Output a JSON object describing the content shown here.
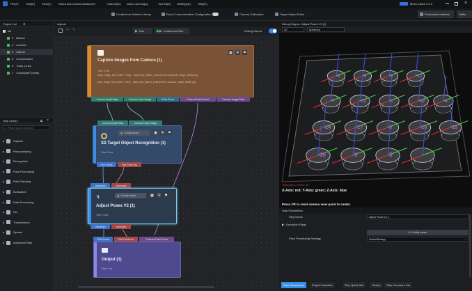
{
  "menubar": {
    "items": [
      "File(F)",
      "Edit(E)",
      "View(V)",
      "Robot and Communication(R)",
      "Camera(C)",
      "Deep Learning(L)",
      "Tool Kit(K)",
      "Settings(S)",
      "Help(H)"
    ],
    "brand": "Mech-Vision 2.0.0"
  },
  "toolbar": {
    "create_from_solution": "Create from Solution Library",
    "robot_comm_config": "Robot Communication Configuration",
    "camera_calibration": "Camera Calibration",
    "target_object_editor": "Target Object Editor",
    "production_interface": "Production Interface",
    "extra": "Settin"
  },
  "project_list": {
    "title": "Project List",
    "items": [
      {
        "index": "",
        "label": "list"
      },
      {
        "index": "2",
        "label": "Beams"
      },
      {
        "index": "3",
        "label": "connect"
      },
      {
        "index": "4",
        "label": "objects"
      },
      {
        "index": "5",
        "label": "Compression"
      },
      {
        "index": "6",
        "label": "Track_Links"
      },
      {
        "index": "7",
        "label": "Crankshaft (Small)"
      }
    ]
  },
  "step_library": {
    "title": "Step Library",
    "search_placeholder": "Please input a keyword",
    "items": [
      "Capture",
      "Preprocessing",
      "Recognition",
      "Pose Processing",
      "Path Planning",
      "Evaluation",
      "Data Processing",
      "File",
      "Transmission",
      "System",
      "Advanced Step"
    ]
  },
  "canvas": {
    "tab": "objects",
    "run_label": "Run",
    "continuous_run_label": "Continuous Run",
    "debug_output_label": "Debug Output",
    "nodes": {
      "capture": {
        "title": "Capture Images from Camera (1)",
        "time": "Time: 27ms",
        "line1": "depth_image_size: [1280 * 1024]...  /Mech-Eye_Stereo_2023-05-09-1-ms/depth_image_00000.png",
        "line2": "color_image_size: [1280 * 1024]...  /Mech-Eye_Stereo_2023-05-09-1-ms/color_image_00000.png",
        "outputs": [
          "Camera Depth Map",
          "Camera Color Image",
          "Point Cloud",
          "Colored Point Cloud",
          "Camera Image Path"
        ]
      },
      "recognition": {
        "inputs": [
          "Camera Depth Map",
          "Camera Color Image"
        ],
        "config_label": "Config wizard",
        "title": "3D Target Object Recognition (1)",
        "time": "Time: 94ms",
        "outputs": [
          "Pick Points",
          "Pick Point Info"
        ]
      },
      "adjust": {
        "inputs": [
          "Obstacles",
          "Unknown"
        ],
        "config_label": "Config wizard",
        "title": "Adjust Poses V2 (1)",
        "time": "Time: 14ms",
        "outputs": [
          "Obstacles",
          "Unknown"
        ]
      },
      "output": {
        "inputs": [
          "Pick Points",
          "Pick Point Info",
          "Colored Point Cloud"
        ],
        "title": "Output (1)",
        "time": "Time: 1ms"
      }
    }
  },
  "debug_output": {
    "title": "Debug Output - Adjust Poses V2 (1)",
    "view_mode": "3D",
    "display_mode": "Numerical",
    "pick_info": "Total pick 1, index: 15",
    "axis_info": "X-Axis: red; Y-Axis: green; Z-Axis: blue",
    "hint": "Press r/R to reset camera view point to center.",
    "markers": [
      "8",
      "6",
      "2",
      "13",
      "7",
      "11",
      "1",
      "12",
      "4",
      "14",
      "17",
      "3",
      "10",
      "15",
      "16",
      "9",
      "5"
    ]
  },
  "step_parameters": {
    "title": "Step Parameters",
    "step_name_label": "Step Name",
    "step_name_value": "Adjust Poses V2_1",
    "execution_flags_label": "Execution Flags",
    "config_wizard_label": "Config wizard",
    "pose_strategy_label": "Pose Processing Strategy",
    "pose_strategy_value": "DefaultStrategy"
  },
  "bottom_tabs": [
    "Step Parameters",
    "Project Assistant",
    "Step Quick Info",
    "History",
    "Step Comment List"
  ],
  "colors": {
    "accent": "#3b8ee8",
    "capture_node": "#8a5a38",
    "recognition_node": "#3f5c8a",
    "adjust_node": "#2f4258",
    "output_node": "#4d4a8f"
  }
}
